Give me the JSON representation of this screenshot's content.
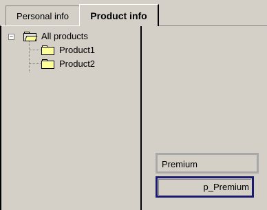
{
  "tabs": {
    "personal_label": "Personal info",
    "product_label": "Product info",
    "active": "Product info"
  },
  "tree": {
    "root_label": "All products",
    "root_expander": "−",
    "children": [
      "Product1",
      "Product2"
    ]
  },
  "fields": {
    "premium_label": "Premium",
    "premium_value": "p_Premium"
  },
  "colors": {
    "background": "#d4d0c8",
    "folder": "#ffff99",
    "focus_border": "#1a1a6e"
  }
}
